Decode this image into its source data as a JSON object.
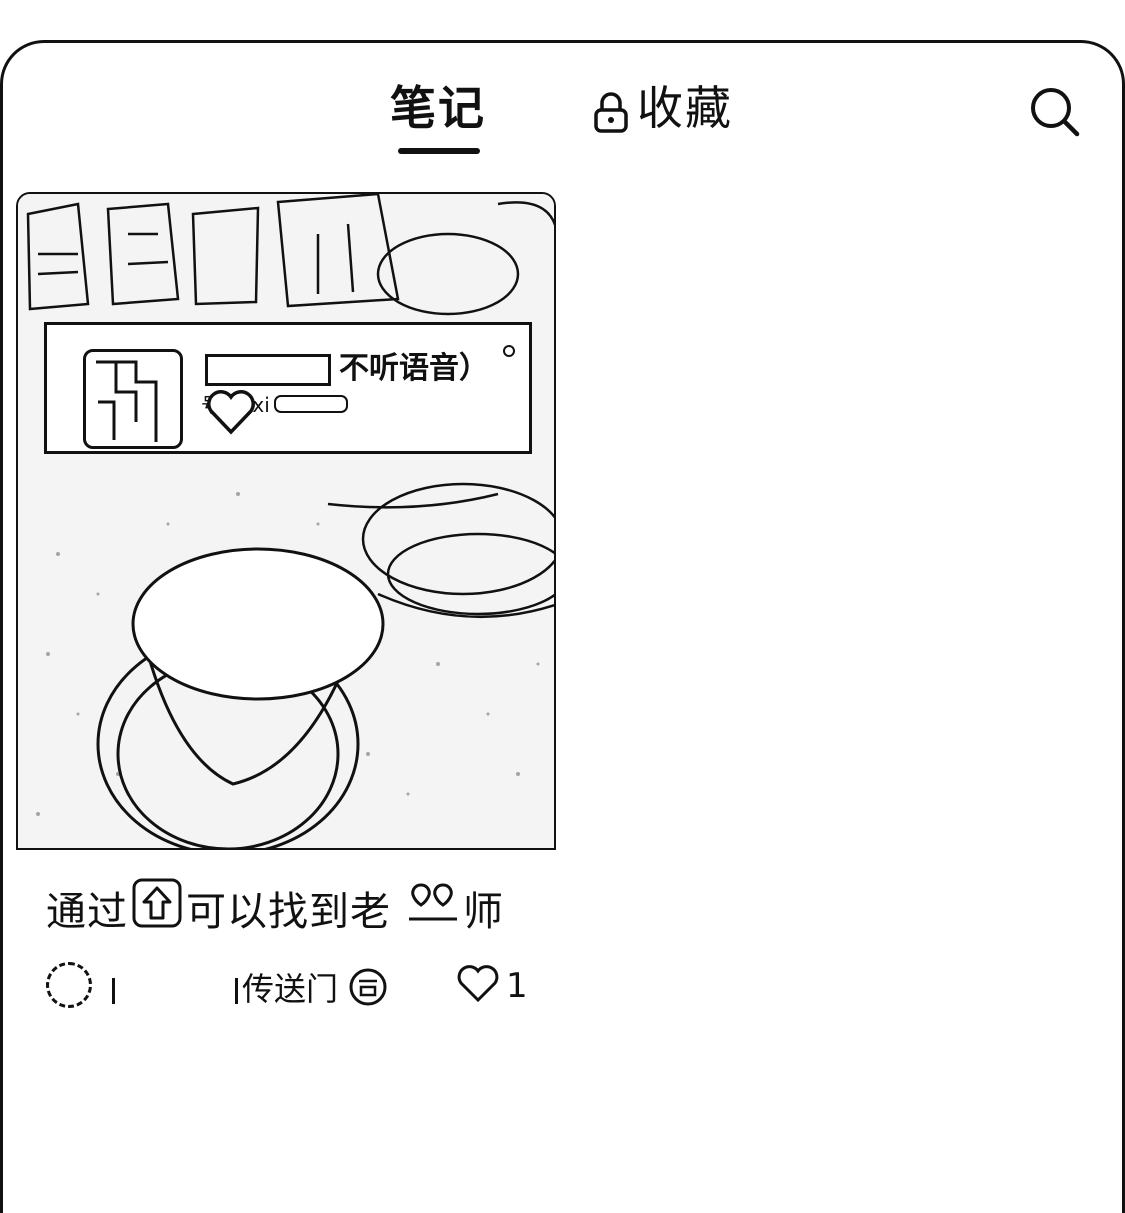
{
  "tabs": {
    "notes_label": "笔记",
    "favorites_label": "收藏"
  },
  "icons": {
    "lock": "lock-icon",
    "search": "search-icon",
    "like": "heart-icon"
  },
  "note": {
    "cover_overlay_title": "不听语音）",
    "cover_overlay_sub": "号:hexi",
    "title_part1": "通过",
    "title_part2": "可以找到老",
    "title_part3": "师",
    "author": "传送门",
    "likes": "1"
  }
}
